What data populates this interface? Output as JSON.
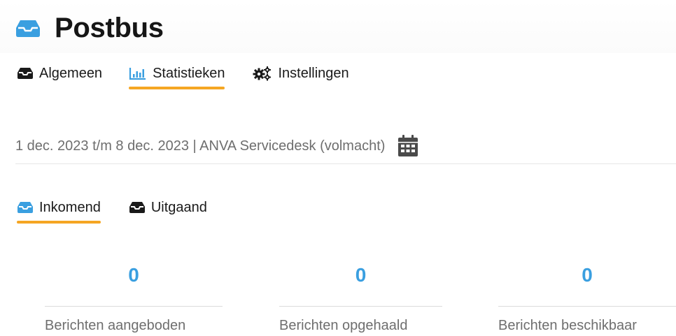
{
  "header": {
    "title": "Postbus",
    "icon": "inbox-tray-icon",
    "accent_color": "#3a9fe0"
  },
  "main_tabs": [
    {
      "label": "Algemeen",
      "icon": "inbox-tray-icon",
      "active": false
    },
    {
      "label": "Statistieken",
      "icon": "bar-chart-icon",
      "active": true
    },
    {
      "label": "Instellingen",
      "icon": "gears-icon",
      "active": false
    }
  ],
  "filter": {
    "date_range_text": "1 dec. 2023 t/m 8 dec. 2023 | ANVA Servicedesk (volmacht)",
    "icon": "calendar-icon"
  },
  "sub_tabs": [
    {
      "label": "Inkomend",
      "icon": "inbox-tray-icon",
      "active": true
    },
    {
      "label": "Uitgaand",
      "icon": "inbox-tray-icon",
      "active": false
    }
  ],
  "stats": [
    {
      "value": "0",
      "caption": "Berichten aangeboden"
    },
    {
      "value": "0",
      "caption": "Berichten opgehaald"
    },
    {
      "value": "0",
      "caption": "Berichten beschikbaar"
    }
  ],
  "colors": {
    "active_underline": "#f5a623",
    "stat_value": "#3a9fe0",
    "muted_text": "#6e6e6e"
  }
}
